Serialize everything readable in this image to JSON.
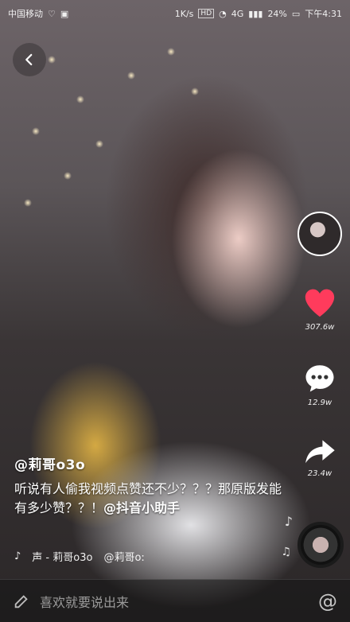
{
  "status_bar": {
    "carrier": "中国移动",
    "speed": "1K/s",
    "hd": "HD",
    "network": "4G",
    "battery": "24%",
    "time": "下午4:31"
  },
  "actions": {
    "like_count": "307.6w",
    "comment_count": "12.9w",
    "share_count": "23.4w"
  },
  "caption": {
    "author": "@莉哥o3o",
    "text_main": "听说有人偷我视频点赞还不少？？？那原版发能有多少赞？？！",
    "mention": "@抖音小助手"
  },
  "music": {
    "label": "声 - 莉哥o3o",
    "label_cont": "@莉哥o:"
  },
  "comment_input": {
    "placeholder": "喜欢就要说出来"
  },
  "colors": {
    "like": "#ff3b5c",
    "text": "#ffffff"
  },
  "icons": [
    "back-icon",
    "heart-icon",
    "comment-icon",
    "share-icon",
    "music-note-icon",
    "tiktok-logo-icon",
    "pencil-icon",
    "at-icon"
  ]
}
